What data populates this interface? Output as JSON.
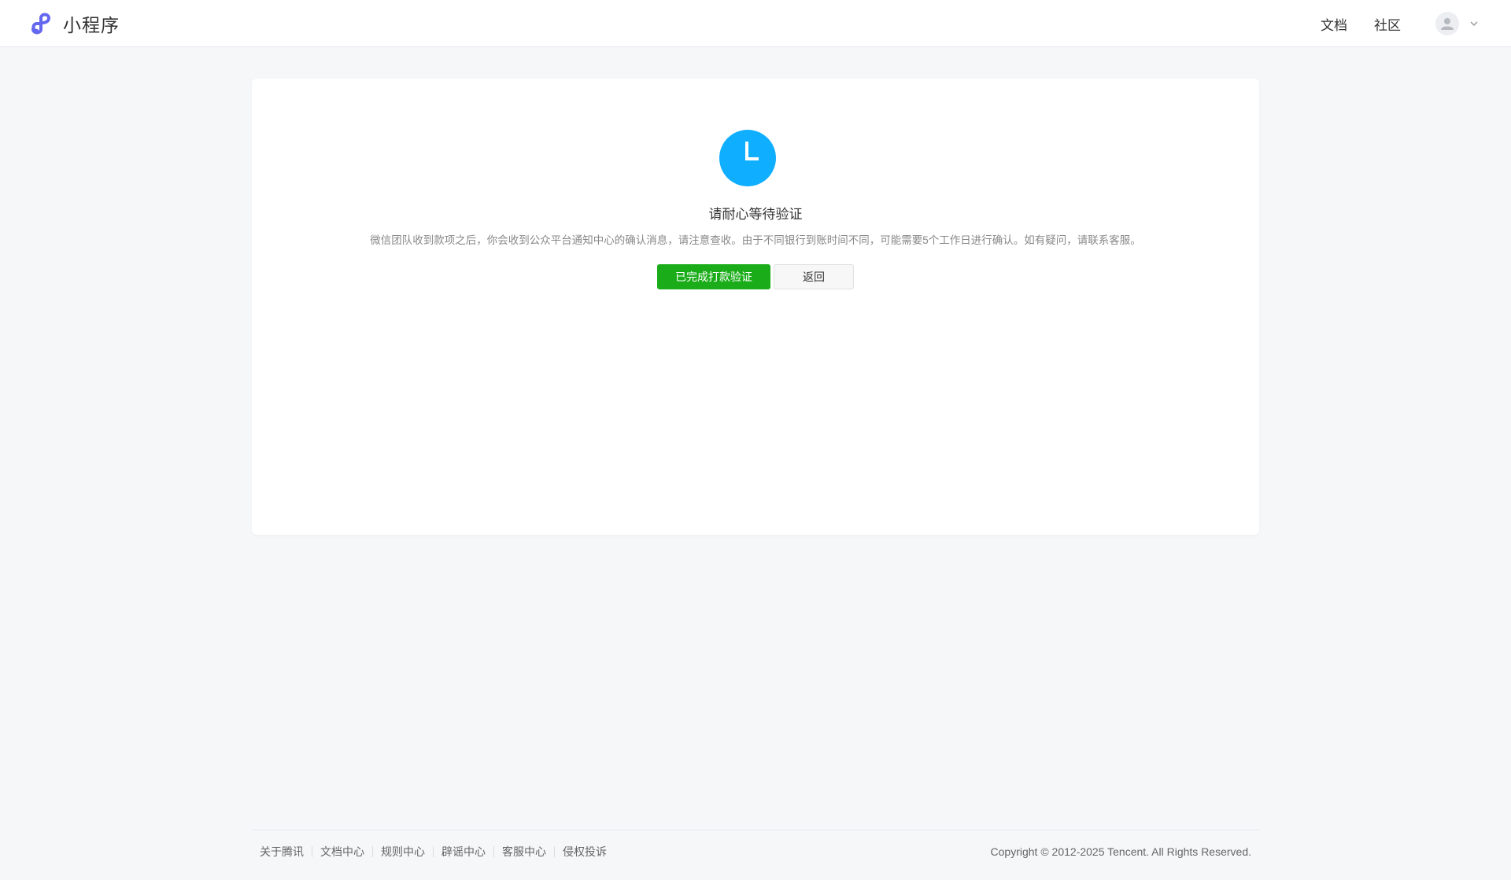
{
  "header": {
    "logo_text": "小程序",
    "nav": [
      {
        "label": "文档"
      },
      {
        "label": "社区"
      }
    ]
  },
  "status": {
    "icon": "waiting-clock-icon",
    "title": "请耐心等待验证",
    "description": "微信团队收到款项之后，你会收到公众平台通知中心的确认消息，请注意查收。由于不同银行到账时间不同，可能需要5个工作日进行确认。如有疑问，请联系客服。",
    "primary_label": "已完成打款验证",
    "back_label": "返回"
  },
  "footer": {
    "links": [
      {
        "label": "关于腾讯"
      },
      {
        "label": "文档中心"
      },
      {
        "label": "规则中心"
      },
      {
        "label": "辟谣中心"
      },
      {
        "label": "客服中心"
      },
      {
        "label": "侵权投诉"
      }
    ],
    "copyright": "Copyright © 2012-2025 Tencent. All Rights Reserved."
  },
  "colors": {
    "accent_green": "#1aad19",
    "waiting_blue": "#10aeff",
    "logo_purple": "#6467f0"
  }
}
